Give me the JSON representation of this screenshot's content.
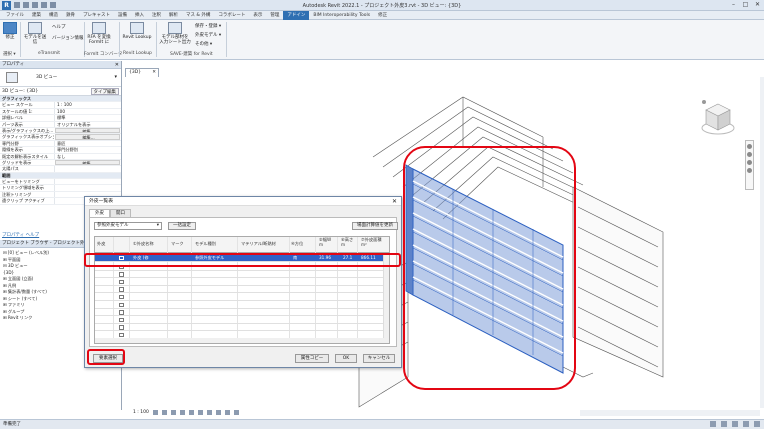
{
  "titlebar": {
    "app_title": "Autodesk Revit 2022.1 - プロジェクト外皮3.rvt - 3D ビュー: {3D}",
    "logo": "R"
  },
  "ribbon_tabs": [
    "ファイル",
    "建築",
    "構造",
    "鉄骨",
    "プレキャスト",
    "設備",
    "挿入",
    "注釈",
    "解析",
    "マス & 外構",
    "コラボレート",
    "表示",
    "管理",
    "アドイン",
    "BIM Interoperability Tools",
    "修正"
  ],
  "ribbon_active_tab": "アドイン",
  "ribbon": {
    "modify_label": "修正",
    "select_label": "選択 ▾",
    "model_check_label": "モデルを送信",
    "help_label": "ヘルプ",
    "version_label": "バージョン情報",
    "etransmit_panel": "eTransmit",
    "formit_label": "RFA を変換\nFormIt に",
    "formit_panel": "FormIt コンバータ",
    "revit_lookup_label": "Revit Lookup",
    "revit_lookup_panel": "Revit Lookup",
    "model_export_label": "モデル部材を\n入力シート出力",
    "save_label": "保存・登録 ▾",
    "exterior_label": "外皮モデル ▾",
    "other_label": "その他 ▾",
    "save_panel": "SAVE-建築 for Revit"
  },
  "properties": {
    "header": "プロパティ",
    "type_name": "3D ビュー",
    "instance_selector": "3D ビュー: {3D}",
    "edit_type": "タイプ編集",
    "rows": [
      {
        "k": "グラフィックス",
        "v": "",
        "section": true
      },
      {
        "k": "ビュー スケール",
        "v": "1 : 100"
      },
      {
        "k": "スケールの値  1:",
        "v": "100"
      },
      {
        "k": "詳細レベル",
        "v": "標準"
      },
      {
        "k": "パーツ表示",
        "v": "オリジナルを表示"
      },
      {
        "k": "表示/グラフィックスの上...",
        "v": "編集...",
        "btn": true
      },
      {
        "k": "グラフィックス表示オプション",
        "v": "編集...",
        "btn": true
      },
      {
        "k": "専門分野",
        "v": "意匠"
      },
      {
        "k": "隠線を表示",
        "v": "専門分野別"
      },
      {
        "k": "既定の解析表示スタイル",
        "v": "なし"
      },
      {
        "k": "グリッドを表示",
        "v": "編集...",
        "btn": true
      },
      {
        "k": "太陽パス",
        "v": ""
      },
      {
        "k": "範囲",
        "v": "",
        "section": true
      },
      {
        "k": "ビューをトリミング",
        "v": ""
      },
      {
        "k": "トリミング領域を表示",
        "v": ""
      },
      {
        "k": "注釈トリミング",
        "v": ""
      },
      {
        "k": "遠クリップ アクティブ",
        "v": ""
      }
    ],
    "help_link": "プロパティ ヘルプ",
    "apply_label": "適用"
  },
  "browser": {
    "header": "プロジェクト ブラウザ - プロジェクト外皮3.rvt",
    "items": [
      "⊟ [0] ビュー (レベル別)",
      "   ⊞ 平面図",
      "   ⊟ 3D ビュー",
      "        {3D}",
      "   ⊞ 立面図 (立面)",
      "⊞ 凡例",
      "⊞ 集計表/数量 (すべて)",
      "⊞ シート (すべて)",
      "⊞ ファミリ",
      "⊞ グループ",
      "⊞ Revit リンク"
    ]
  },
  "view_tab": "{3D}",
  "view_control": {
    "scale": "1 : 100"
  },
  "statusbar": {
    "text": "準備完了"
  },
  "dialog": {
    "title": "外皮一覧表",
    "tabs": [
      "外皮",
      "開口"
    ],
    "active_tab": "外皮",
    "filter_value": "参照外皮モデル",
    "set_button": "一括設定",
    "update_button": "場面計算値を更新",
    "columns": [
      "外皮",
      "①外皮名称",
      "マーク",
      "モデル種別",
      "マテリアル/断熱材",
      "④方位",
      "⑤幅W\nm",
      "⑥高さ\nm",
      "⑦外皮面積\nm²"
    ],
    "selected_row": {
      "name": "外皮 (修",
      "type": "参照外皮モデル",
      "dir": "南",
      "w": "31.96",
      "h": "27.1",
      "area": "866.11"
    },
    "empty_rows": 11,
    "btn_select": "要素選択",
    "btn_copy": "属性コピー",
    "btn_ok": "OK",
    "btn_cancel": "キャンセル"
  },
  "colors": {
    "accent": "#2f6fb2",
    "selection": "#2f62c8",
    "highlight": "#e30613"
  }
}
